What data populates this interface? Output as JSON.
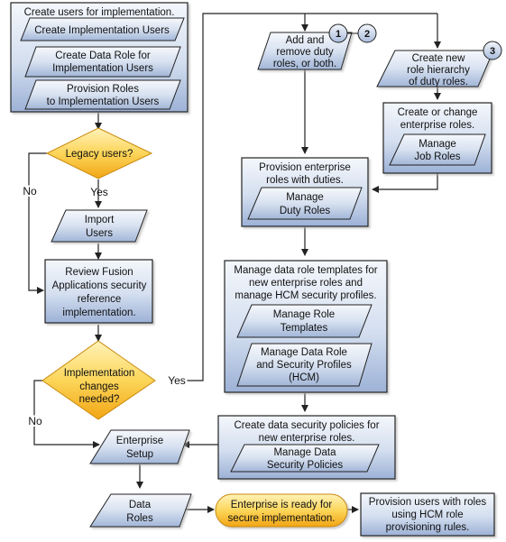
{
  "colors": {
    "box_fill_top": "#f3f6fb",
    "box_fill_bottom": "#9fb3d6",
    "decision_top": "#fde89a",
    "decision_bottom": "#f2a618",
    "stroke": "#222222"
  },
  "nodes": {
    "create_users_group": {
      "title": "Create users for implementation.",
      "tasks": [
        {
          "lines": [
            "Create Implementation Users"
          ]
        },
        {
          "lines": [
            "Create Data Role for",
            "Implementation Users"
          ]
        },
        {
          "lines": [
            "Provision Roles",
            "to Implementation Users"
          ]
        }
      ]
    },
    "legacy_decision": {
      "lines": [
        "Legacy users?"
      ]
    },
    "import_users": {
      "lines": [
        "Import",
        "Users"
      ]
    },
    "review_fusion": {
      "lines": [
        "Review Fusion",
        "Applications security",
        "reference",
        "implementation."
      ]
    },
    "impl_changes_decision": {
      "lines": [
        "Implementation",
        "changes",
        "needed?"
      ]
    },
    "enterprise_setup": {
      "lines": [
        "Enterprise",
        "Setup"
      ]
    },
    "data_roles": {
      "lines": [
        "Data",
        "Roles"
      ]
    },
    "ready_terminal": {
      "lines": [
        "Enterprise is ready for",
        "secure implementation."
      ]
    },
    "provision_users_hcm": {
      "lines": [
        "Provision users with roles",
        "using HCM role",
        "provisioning rules."
      ]
    },
    "add_remove_duty": {
      "lines": [
        "Add and",
        "remove duty",
        "roles, or both."
      ],
      "badges": [
        "1",
        "2"
      ]
    },
    "create_role_hierarchy": {
      "lines": [
        "Create new",
        "role hierarchy",
        "of duty roles."
      ],
      "badges": [
        "3"
      ]
    },
    "change_enterprise_roles": {
      "title_lines": [
        "Create or change",
        "enterprise roles."
      ],
      "task_lines": [
        "Manage",
        "Job Roles"
      ]
    },
    "provision_enterprise_roles": {
      "title_lines": [
        "Provision enterprise",
        "roles with duties."
      ],
      "task_lines": [
        "Manage",
        "Duty Roles"
      ]
    },
    "manage_templates": {
      "title_lines": [
        "Manage data role templates for",
        "new enterprise roles and",
        "manage HCM security profiles."
      ],
      "tasks": [
        {
          "lines": [
            "Manage Role",
            "Templates"
          ]
        },
        {
          "lines": [
            "Manage Data Role",
            "and Security Profiles",
            "(HCM)"
          ]
        }
      ]
    },
    "data_security_policies": {
      "title_lines": [
        "Create data security policies for",
        "new enterprise roles."
      ],
      "task_lines": [
        "Manage Data",
        "Security Policies"
      ]
    }
  },
  "edge_labels": {
    "legacy_yes": "Yes",
    "legacy_no": "No",
    "changes_yes": "Yes",
    "changes_no": "No"
  }
}
